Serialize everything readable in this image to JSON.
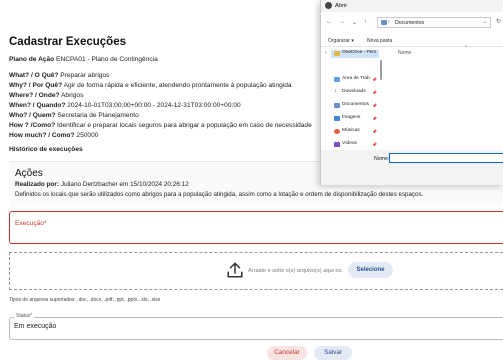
{
  "page": {
    "title": "Cadastrar Execuções",
    "plan_label": "Plano de Ação",
    "plan_value": "ENCPA01 - Plano de Contingência",
    "what_label": "What? / O Quê?",
    "what_value": "Preparar abrigos",
    "why_label": "Why? / Por Quê?",
    "why_value": "Agir de forma rápida e eficiente, atendendo prontamente à população atingida",
    "where_label": "Where? / Onde?",
    "where_value": "Abrigos",
    "when_label": "When? / Quando?",
    "when_value": "2024-10-01T03:00:00+00:00 - 2024-12-31T03:00:00+00:00",
    "who_label": "Who? / Quem?",
    "who_value": "Secretaria de Planejamento",
    "how_label": "How ? /Como?",
    "how_value": "Identificar e preparar locais seguros para abrigar a população em caso de necessidade",
    "howmuch_label": "How much? / Como?",
    "howmuch_value": "250000",
    "history_title": "Histórico de execuções"
  },
  "history": {
    "title": "Ações",
    "by_label": "Realizado por:",
    "by_value": "Juliano Dertzbacher em 15/10/2024 20:26:12",
    "description": "Definidos os locais que serão utilizados como abrigos para a população atingida, assim como a lotação e ordem de disponibilização destes espaços."
  },
  "form": {
    "execution_label": "Execução*",
    "dropzone_text": "Arraste e solte o(s) arquivo(s) aqui ou",
    "select_button": "Selecione",
    "file_types": "Tipos de arquivos suportados: .doc, .docx, .pdf, .ppt, .pptx, .xls, .xlsx",
    "status_label": "Status*",
    "status_value": "Em execução",
    "cancel_button": "Cancelar",
    "save_button": "Salvar"
  },
  "dialog": {
    "title": "Abrir",
    "path_folder": "Documentos",
    "toolbar_organize": "Organizar ▾",
    "toolbar_new_folder": "Nova pasta",
    "sidebar_items": [
      "OneDrive - Pers",
      "Área de Trab",
      "Downloads",
      "Documentos",
      "Imagens",
      "Músicas",
      "Vídeos"
    ],
    "column_name": "Nome",
    "filename_label": "Nome:",
    "filename_value": ""
  },
  "colors": {
    "accent": "#2b4f8a",
    "error": "#c0392b",
    "folder": "#e6b84c"
  }
}
